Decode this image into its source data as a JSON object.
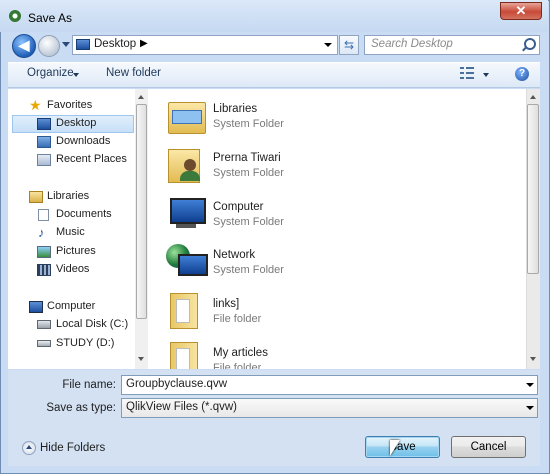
{
  "window": {
    "title": "Save As",
    "close_label": "✕"
  },
  "nav": {
    "location": "Desktop",
    "search_placeholder": "Search Desktop"
  },
  "toolbar": {
    "organize_label": "Organize",
    "new_folder_label": "New folder",
    "help_label": "?"
  },
  "sidebar": {
    "favorites": {
      "label": "Favorites",
      "items": [
        {
          "label": "Desktop"
        },
        {
          "label": "Downloads"
        },
        {
          "label": "Recent Places"
        }
      ]
    },
    "libraries": {
      "label": "Libraries",
      "items": [
        {
          "label": "Documents"
        },
        {
          "label": "Music"
        },
        {
          "label": "Pictures"
        },
        {
          "label": "Videos"
        }
      ]
    },
    "computer": {
      "label": "Computer",
      "items": [
        {
          "label": "Local Disk (C:)"
        },
        {
          "label": "STUDY (D:)"
        }
      ]
    }
  },
  "files": [
    {
      "name": "Libraries",
      "type": "System Folder",
      "icon": "libraries-icon"
    },
    {
      "name": "Prerna Tiwari",
      "type": "System Folder",
      "icon": "user-folder-icon"
    },
    {
      "name": "Computer",
      "type": "System Folder",
      "icon": "computer-icon"
    },
    {
      "name": "Network",
      "type": "System Folder",
      "icon": "network-icon"
    },
    {
      "name": "links]",
      "type": "File folder",
      "icon": "folder-icon"
    },
    {
      "name": "My articles",
      "type": "File folder",
      "icon": "folder-icon"
    }
  ],
  "form": {
    "file_name_label": "File name:",
    "file_name_value": "Groupbyclause.qvw",
    "save_type_label": "Save as type:",
    "save_type_value": "QlikView Files (*.qvw)"
  },
  "footer": {
    "hide_folders_label": "Hide Folders",
    "save_label": "Save",
    "cancel_label": "Cancel"
  },
  "colors": {
    "chrome": "#c9dcf3",
    "selection": "#c7e0f8",
    "primary_button": "#98d1ef"
  }
}
